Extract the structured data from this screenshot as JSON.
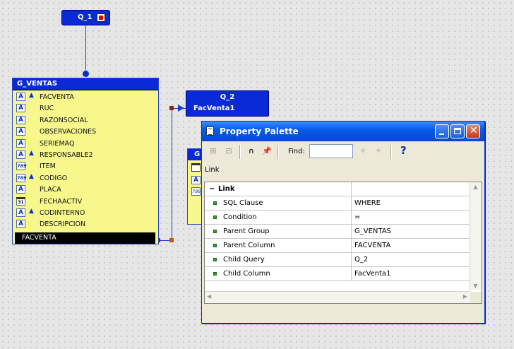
{
  "query1": {
    "name": "Q_1"
  },
  "group1": {
    "name": "G_VENTAS",
    "items": [
      {
        "name": "FACVENTA",
        "type": "A",
        "kind": "char",
        "arrow": true
      },
      {
        "name": "RUC",
        "type": "A",
        "kind": "char",
        "arrow": false
      },
      {
        "name": "RAZONSOCIAL",
        "type": "A",
        "kind": "char",
        "arrow": false
      },
      {
        "name": "OBSERVACIONES",
        "type": "A",
        "kind": "char",
        "arrow": false
      },
      {
        "name": "SERIEMAQ",
        "type": "A",
        "kind": "char",
        "arrow": false
      },
      {
        "name": "RESPONSABLE2",
        "type": "A",
        "kind": "char",
        "arrow": true
      },
      {
        "name": "ITEM",
        "type": "789",
        "kind": "num",
        "arrow": false
      },
      {
        "name": "CODIGO",
        "type": "789",
        "kind": "num",
        "arrow": true
      },
      {
        "name": "PLACA",
        "type": "A",
        "kind": "char",
        "arrow": false
      },
      {
        "name": "FECHAACTIV",
        "type": "31",
        "kind": "date",
        "arrow": false
      },
      {
        "name": "CODINTERNO",
        "type": "A",
        "kind": "char",
        "arrow": true
      },
      {
        "name": "DESCRIPCION",
        "type": "A",
        "kind": "char",
        "arrow": false
      }
    ],
    "selected": "FACVENTA"
  },
  "query2": {
    "name": "Q_2",
    "column": "FacVenta1"
  },
  "group2": {
    "name": "G"
  },
  "palette": {
    "title": "Property Palette",
    "find_label": "Find:",
    "find_value": "",
    "context": "Link",
    "section": "Link",
    "properties": [
      {
        "name": "SQL Clause",
        "value": "WHERE"
      },
      {
        "name": "Condition",
        "value": "="
      },
      {
        "name": "Parent Group",
        "value": "G_VENTAS"
      },
      {
        "name": "Parent Column",
        "value": "FACVENTA"
      },
      {
        "name": "Child Query",
        "value": "Q_2"
      },
      {
        "name": "Child Column",
        "value": "FacVenta1"
      }
    ]
  }
}
